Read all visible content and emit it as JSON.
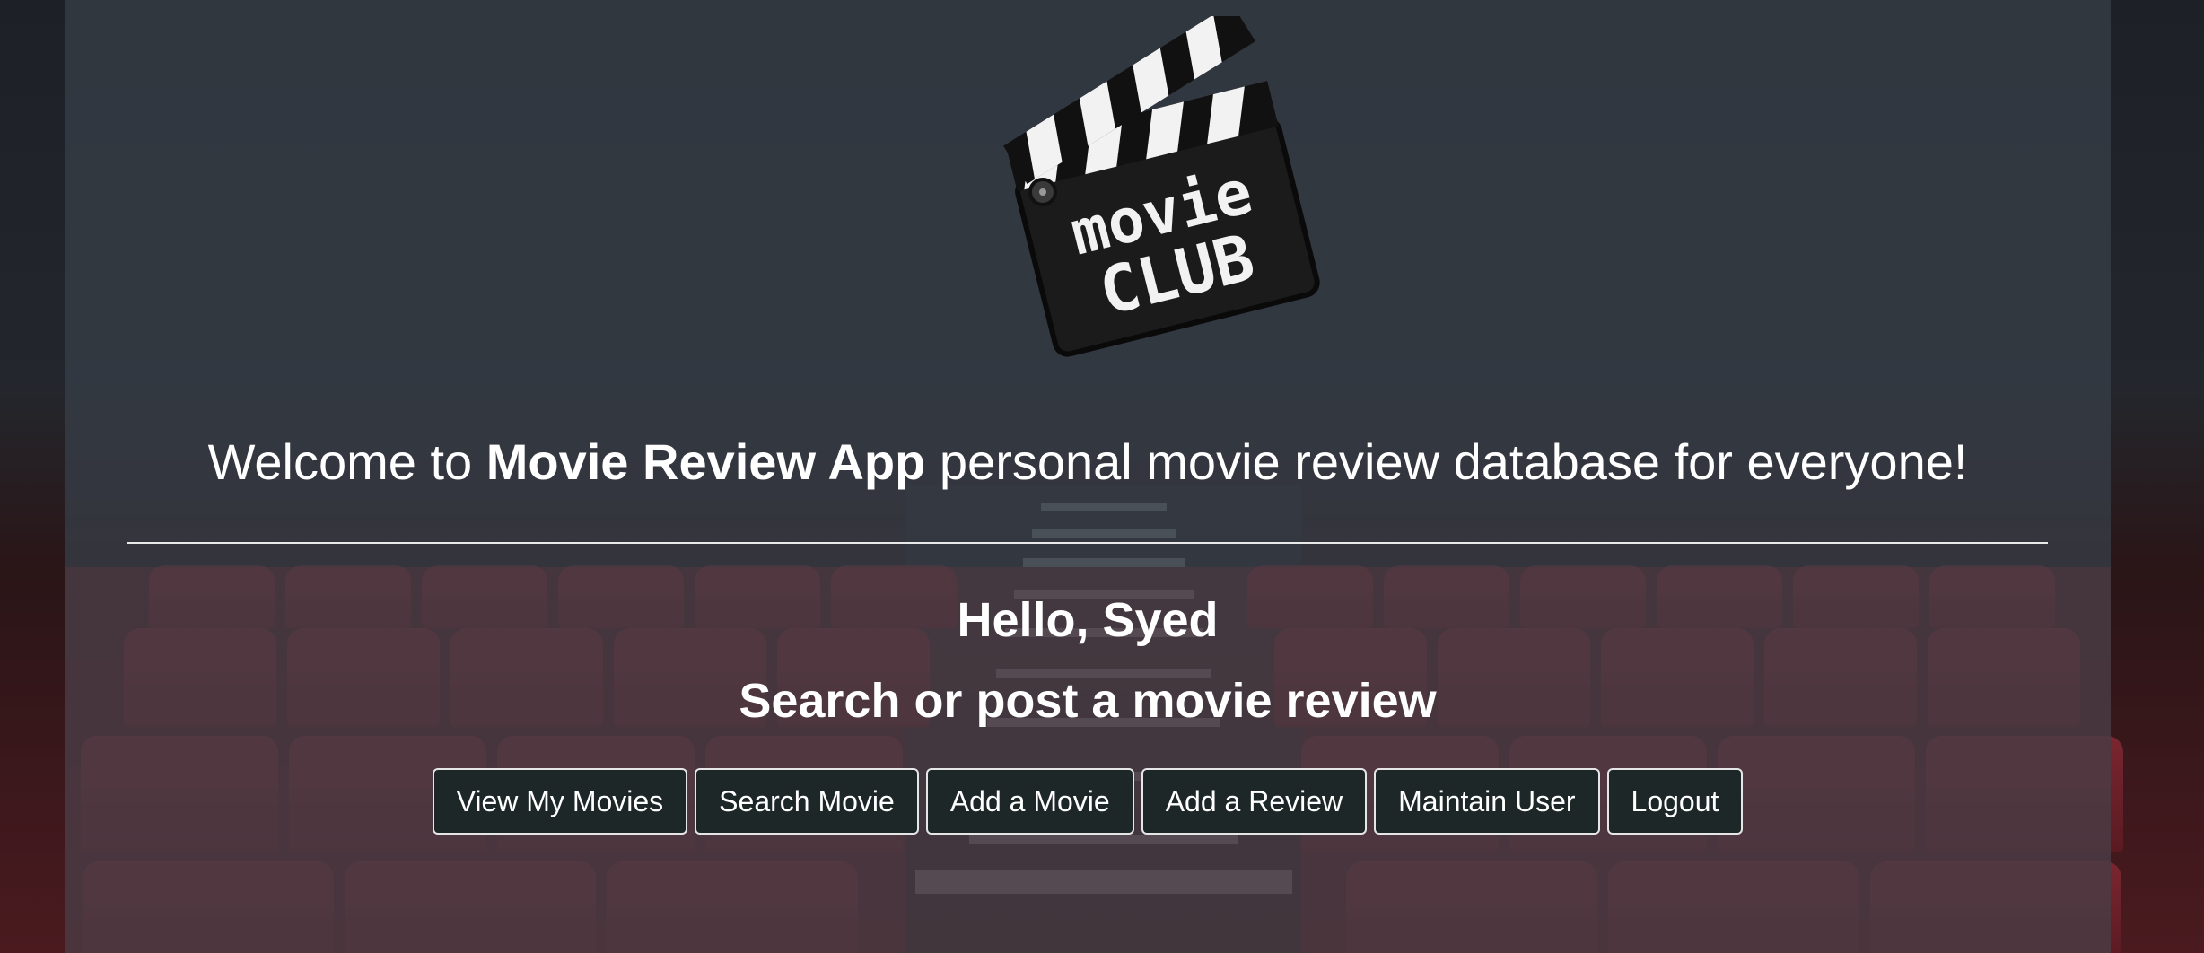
{
  "logo": {
    "line1": "movie",
    "line2": "CLUB"
  },
  "welcome": {
    "prefix": "Welcome to ",
    "app_name": "Movie Review App",
    "suffix": " personal movie review database for everyone!"
  },
  "greeting": "Hello, Syed",
  "subtitle": "Search or post a movie review",
  "nav": {
    "view_my_movies": "View My Movies",
    "search_movie": "Search Movie",
    "add_movie": "Add a Movie",
    "add_review": "Add a Review",
    "maintain_user": "Maintain User",
    "logout": "Logout"
  },
  "colors": {
    "button_bg": "#1e2727",
    "seat": "#7a2630",
    "overlay": "#373e47"
  }
}
